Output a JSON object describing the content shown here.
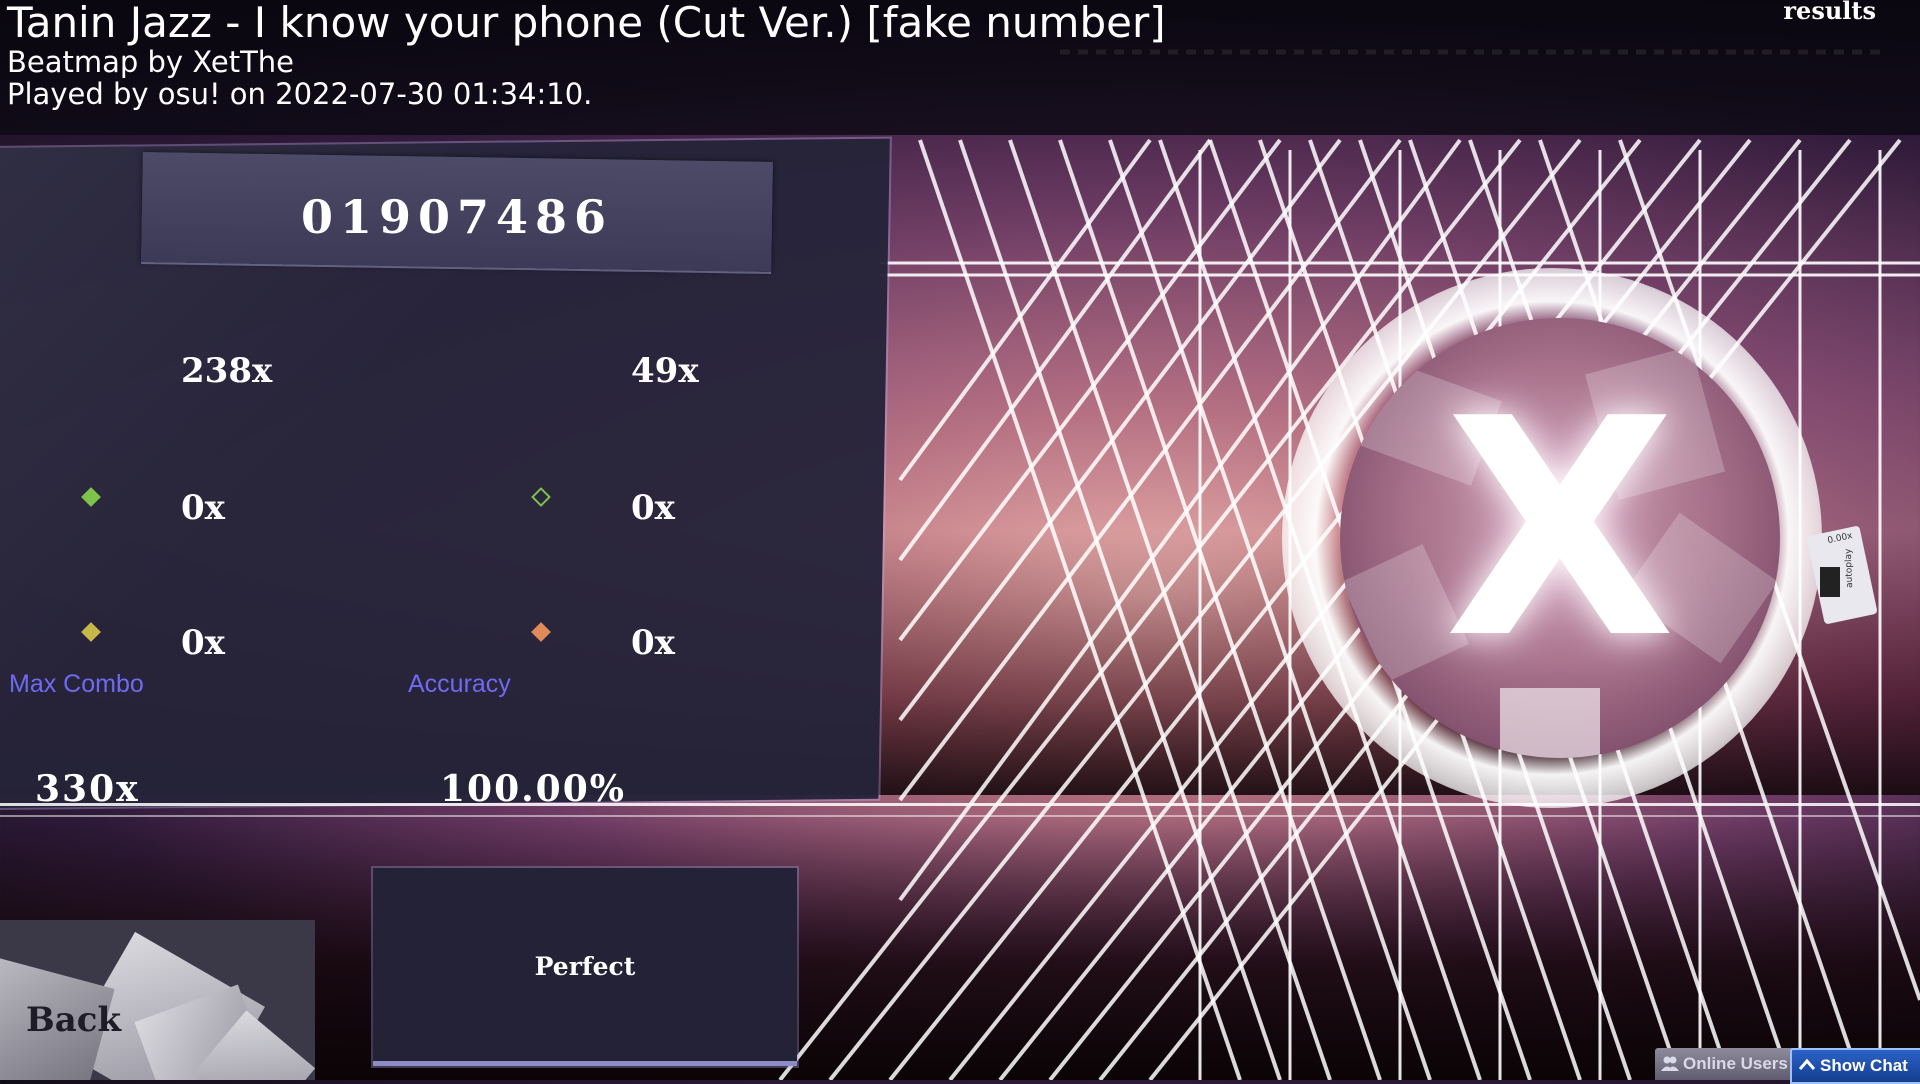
{
  "header": {
    "title": "Tanin Jazz - I know your phone (Cut Ver.) [fake number]",
    "mapper": "Beatmap by XetThe",
    "played": "Played by osu! on 2022-07-30 01:34:10.",
    "screen_label": "results"
  },
  "score": {
    "value": "01907486"
  },
  "hits": {
    "count_300": "238x",
    "count_geki": "49x",
    "count_100": "0x",
    "count_katu": "0x",
    "count_50": "0x",
    "count_miss": "0x"
  },
  "stats": {
    "max_combo_label": "Max Combo",
    "max_combo_value": "330x",
    "accuracy_label": "Accuracy",
    "accuracy_value": "100.00%"
  },
  "grade": {
    "letter": "X"
  },
  "mods": {
    "card_top": "0.00x",
    "card_side": "autoplay"
  },
  "performance": {
    "label": "Perfect"
  },
  "navigation": {
    "back_label": "Back",
    "online_users_label": "Online Users",
    "show_chat_label": "Show Chat"
  },
  "colors": {
    "accent_label": "#6f6af0",
    "panel": "#26243a",
    "chat_button": "#2a62c8"
  },
  "icons": {
    "count_100": "green-diamond-icon",
    "count_katu": "green-outline-diamond-icon",
    "count_50": "yellow-diamond-icon",
    "count_miss": "orange-diamond-icon",
    "online_users": "users-icon",
    "show_chat": "chevron-up-icon"
  }
}
